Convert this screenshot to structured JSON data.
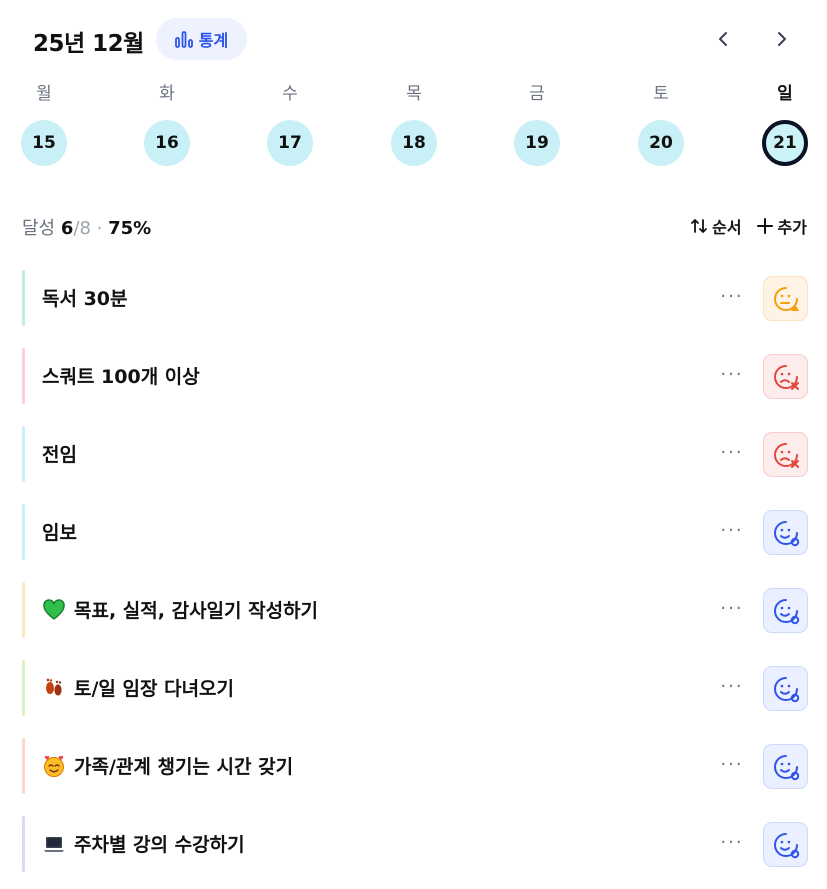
{
  "header": {
    "title": "25년 12월",
    "stats_label": "통계"
  },
  "week": [
    {
      "name": "월",
      "date": "15",
      "today": false
    },
    {
      "name": "화",
      "date": "16",
      "today": false
    },
    {
      "name": "수",
      "date": "17",
      "today": false
    },
    {
      "name": "목",
      "date": "18",
      "today": false
    },
    {
      "name": "금",
      "date": "19",
      "today": false
    },
    {
      "name": "토",
      "date": "20",
      "today": false
    },
    {
      "name": "일",
      "date": "21",
      "today": true
    }
  ],
  "summary": {
    "label": "달성",
    "done": "6",
    "sep": "/",
    "total": "8",
    "dot": "·",
    "percent": "75%"
  },
  "toolbar": {
    "sort_label": "순서",
    "add_label": "추가"
  },
  "habits": [
    {
      "label": "독서 30분",
      "emoji": "",
      "bar_color": "#bfeedd",
      "status": "warning"
    },
    {
      "label": "스쿼트 100개 이상",
      "emoji": "",
      "bar_color": "#fbd0de",
      "status": "fail"
    },
    {
      "label": "전임",
      "emoji": "",
      "bar_color": "#c8f0f6",
      "status": "fail"
    },
    {
      "label": "임보",
      "emoji": "",
      "bar_color": "#c8f0f6",
      "status": "done"
    },
    {
      "label": "목표, 실적, 감사일기 작성하기",
      "emoji": "green-heart",
      "bar_color": "#fbeac0",
      "status": "done"
    },
    {
      "label": "토/일 임장 다녀오기",
      "emoji": "footprints",
      "bar_color": "#d6f3c8",
      "status": "done"
    },
    {
      "label": "가족/관계 챙기는 시간 갖기",
      "emoji": "smiling-hearts",
      "bar_color": "#fbd6d0",
      "status": "done"
    },
    {
      "label": "주차별 강의 수강하기",
      "emoji": "laptop",
      "bar_color": "#d6dcf6",
      "status": "done"
    }
  ],
  "status_styles": {
    "warning": {
      "bg": "#fff3e6",
      "border": "#fde1c0",
      "color": "#f59e0b"
    },
    "fail": {
      "bg": "#fdecec",
      "border": "#f8cccc",
      "color": "#e0483b"
    },
    "done": {
      "bg": "#eaf0ff",
      "border": "#cdd9fb",
      "color": "#2f55e8"
    }
  },
  "icons": {
    "stats": "bar-chart-icon",
    "prev": "chevron-left-icon",
    "next": "chevron-right-icon",
    "sort": "sort-arrows-icon",
    "add": "plus-icon",
    "more": "more-dots-icon"
  }
}
